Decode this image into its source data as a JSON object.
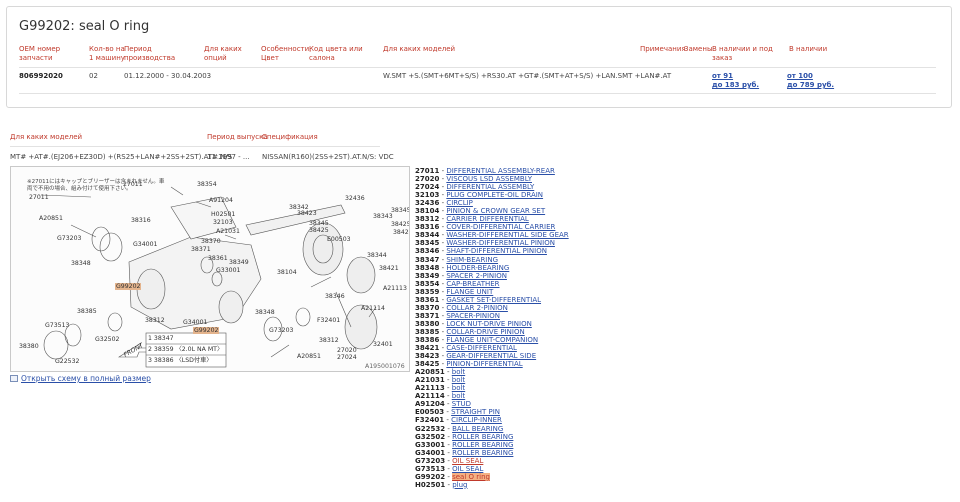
{
  "part": {
    "title": "G99202: seal O ring"
  },
  "table": {
    "headers": [
      "OEM номер запчасти",
      "Кол-во на 1 машину",
      "Период производства",
      "Для каких опций",
      "Особенности, Цвет",
      "Код цвета или салона",
      "Для каких моделей",
      "Примечания",
      "Замены",
      "В наличии и под заказ",
      "В наличии"
    ],
    "row": {
      "oem": "806992020",
      "qty": "02",
      "period": "01.12.2000 - 30.04.2003",
      "models": "W.SMT +S.(SMT+6MT+S/S) +RS30.AT +GT#.(SMT+AT+S/S) +LAN.SMT +LAN#.AT",
      "order_from": "от 91",
      "order_to": "до 183 руб.",
      "stock_from": "от 100",
      "stock_to": "до 789 руб."
    }
  },
  "section": {
    "headers": [
      "Для каких моделей",
      "Период выпуска",
      "Спецификация"
    ],
    "models": "MT# +AT#.(EJ206+EZ30D) +(RS25+LAN#+2SS+2ST).AT#.N/S",
    "period": "11.1997 - ...",
    "spec": "NISSAN(R160)(2SS+2ST).AT.N/S: VDC"
  },
  "diagram": {
    "labels": [
      "38354",
      "A91204",
      "H02501",
      "32103",
      "A21031",
      "38370",
      "38371",
      "38361",
      "38316",
      "A20851",
      "G73203",
      "G34001",
      "38348",
      "38349",
      "G33001",
      "38104",
      "32436",
      "38342",
      "38423",
      "38345",
      "38425",
      "38343",
      "E00503",
      "38344",
      "38421",
      "A21113",
      "38346",
      "F32401",
      "A21114",
      "38312",
      "38385",
      "G73513",
      "G32502",
      "G34001",
      "G99202",
      "38380",
      "G22532",
      "38348",
      "G73203",
      "A20851",
      "27020",
      "27024",
      "27011",
      "32401",
      "38312",
      "38345",
      "38425",
      "38423",
      "27011",
      "G99202"
    ],
    "note_top": "※27011にはキャップとブリーザーは含まれません。車両で不用の場合、組み付けて使用下さい。",
    "legend": [
      {
        "num": "1",
        "code": "38347",
        "note": ""
      },
      {
        "num": "2",
        "code": "38359",
        "note": "〈2.0L NA MT〉"
      },
      {
        "num": "3",
        "code": "38386",
        "note": "〈LSD付車〉"
      }
    ],
    "front_label": "FRONT",
    "figure_id": "A195001076"
  },
  "open_full_link": "Открыть схему в полный размер",
  "parts_list": [
    {
      "code": "27011",
      "name": "DIFFERENTIAL ASSEMBLY-REAR",
      "style": "link"
    },
    {
      "code": "27020",
      "name": "VISCOUS LSD ASSEMBLY",
      "style": "link"
    },
    {
      "code": "27024",
      "name": "DIFFERENTIAL ASSEMBLY",
      "style": "link"
    },
    {
      "code": "32103",
      "name": "PLUG COMPLETE-OIL DRAIN",
      "style": "link"
    },
    {
      "code": "32436",
      "name": "CIRCLIP",
      "style": "link"
    },
    {
      "code": "38104",
      "name": "PINION & CROWN GEAR SET",
      "style": "link"
    },
    {
      "code": "38312",
      "name": "CARRIER DIFFERENTIAL",
      "style": "link"
    },
    {
      "code": "38316",
      "name": "COVER-DIFFERENTIAL CARRIER",
      "style": "link"
    },
    {
      "code": "38344",
      "name": "WASHER-DIFFERENTIAL SIDE GEAR",
      "style": "link"
    },
    {
      "code": "38345",
      "name": "WASHER-DIFFERENTIAL PINION",
      "style": "link"
    },
    {
      "code": "38346",
      "name": "SHAFT-DIFFERENTIAL PINION",
      "style": "link"
    },
    {
      "code": "38347",
      "name": "SHIM-BEARING",
      "style": "link"
    },
    {
      "code": "38348",
      "name": "HOLDER-BEARING",
      "style": "link"
    },
    {
      "code": "38349",
      "name": "SPACER 2-PINION",
      "style": "link"
    },
    {
      "code": "38354",
      "name": "CAP-BREATHER",
      "style": "link"
    },
    {
      "code": "38359",
      "name": "FLANGE UNIT",
      "style": "link"
    },
    {
      "code": "38361",
      "name": "GASKET SET-DIFFERENTIAL",
      "style": "link"
    },
    {
      "code": "38370",
      "name": "COLLAR 2-PINION",
      "style": "link"
    },
    {
      "code": "38371",
      "name": "SPACER-PINION",
      "style": "link"
    },
    {
      "code": "38380",
      "name": "LOCK NUT-DRIVE PINION",
      "style": "link"
    },
    {
      "code": "38385",
      "name": "COLLAR-DRIVE PINION",
      "style": "link"
    },
    {
      "code": "38386",
      "name": "FLANGE UNIT-COMPANION",
      "style": "link"
    },
    {
      "code": "38421",
      "name": "CASE-DIFFERENTIAL",
      "style": "link"
    },
    {
      "code": "38423",
      "name": "GEAR-DIFFERENTIAL SIDE",
      "style": "link"
    },
    {
      "code": "38425",
      "name": "PINION-DIFFERENTIAL",
      "style": "link"
    },
    {
      "code": "A20851",
      "name": "bolt",
      "style": "link"
    },
    {
      "code": "A21031",
      "name": "bolt",
      "style": "link"
    },
    {
      "code": "A21113",
      "name": "bolt",
      "style": "link"
    },
    {
      "code": "A21114",
      "name": "bolt",
      "style": "link"
    },
    {
      "code": "A91204",
      "name": "STUD",
      "style": "link"
    },
    {
      "code": "E00503",
      "name": "STRAIGHT PIN",
      "style": "link"
    },
    {
      "code": "F32401",
      "name": "CIRCLIP-INNER",
      "style": "link"
    },
    {
      "code": "G22532",
      "name": "BALL BEARING",
      "style": "link"
    },
    {
      "code": "G32502",
      "name": "ROLLER BEARING",
      "style": "link"
    },
    {
      "code": "G33001",
      "name": "ROLLER BEARING",
      "style": "link"
    },
    {
      "code": "G34001",
      "name": "ROLLER BEARING",
      "style": "link"
    },
    {
      "code": "G73203",
      "name": "OIL SEAL",
      "style": "red"
    },
    {
      "code": "G73513",
      "name": "OIL SEAL",
      "style": "link"
    },
    {
      "code": "G99202",
      "name": "seal O ring",
      "style": "highlight"
    },
    {
      "code": "H02501",
      "name": "plug",
      "style": "link"
    }
  ],
  "colors": {
    "header_red": "#c0392b",
    "link_blue": "#2a4fa8",
    "highlight": "#f4b183"
  }
}
